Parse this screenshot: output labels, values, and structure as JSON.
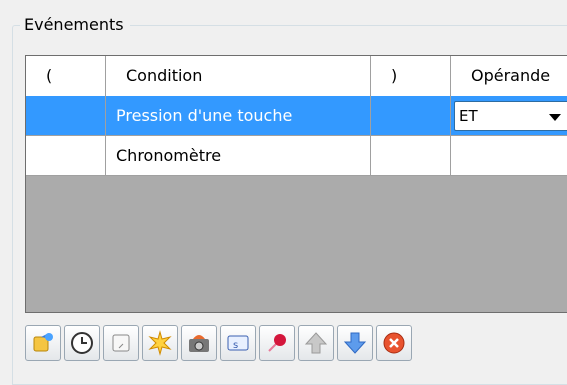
{
  "events_group": {
    "title": "Evénements"
  },
  "grid": {
    "columns": [
      "(",
      "Condition",
      ")",
      "Opérande"
    ],
    "rows": [
      {
        "paren_open": "",
        "condition": "Pression d'une touche",
        "paren_close": "",
        "operand": "ET",
        "selected": true
      },
      {
        "paren_open": "",
        "condition": "Chronomètre",
        "paren_close": "",
        "operand": "",
        "selected": false
      }
    ]
  },
  "toolbar": {
    "buttons": [
      {
        "icon": "add-event-icon"
      },
      {
        "icon": "clock-icon"
      },
      {
        "icon": "blank-condition-icon"
      },
      {
        "icon": "explosion-icon"
      },
      {
        "icon": "camera-icon"
      },
      {
        "icon": "variable-icon"
      },
      {
        "icon": "pin-icon"
      },
      {
        "icon": "move-up-icon"
      },
      {
        "icon": "move-down-icon"
      },
      {
        "icon": "delete-icon"
      }
    ]
  },
  "colors": {
    "selection": "#3399ff",
    "grid_background": "#ababab"
  }
}
